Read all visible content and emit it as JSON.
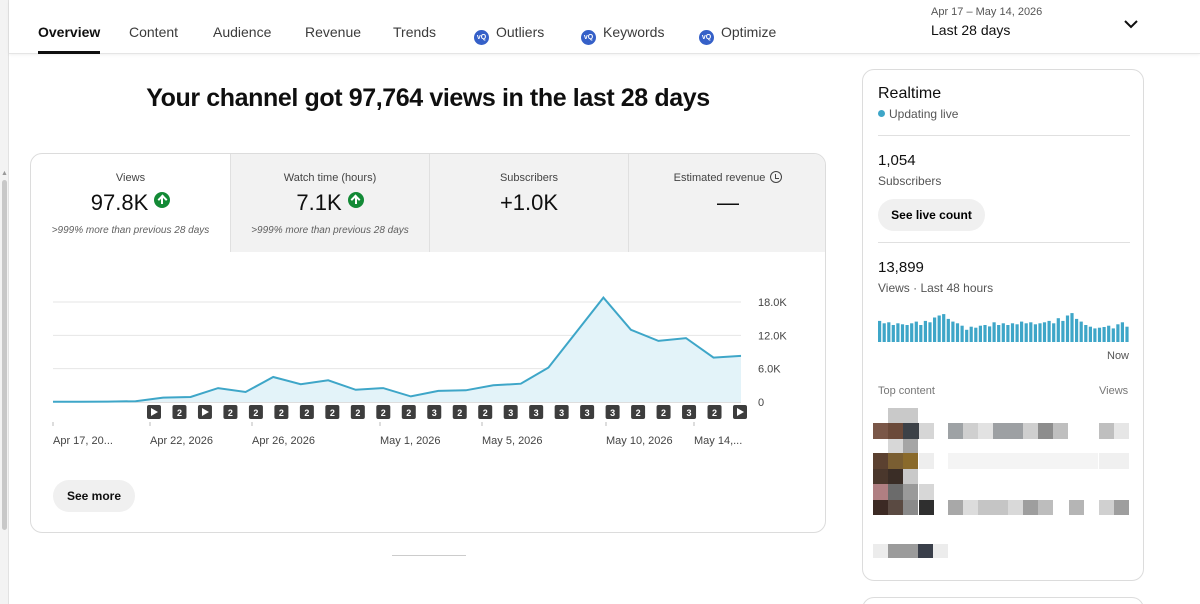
{
  "tabs": [
    {
      "label": "Overview",
      "active": true
    },
    {
      "label": "Content",
      "active": false
    },
    {
      "label": "Audience",
      "active": false
    },
    {
      "label": "Revenue",
      "active": false
    },
    {
      "label": "Trends",
      "active": false
    },
    {
      "label": "Outliers",
      "active": false,
      "icon": "outliers-icon"
    },
    {
      "label": "Keywords",
      "active": false,
      "icon": "keywords-icon"
    },
    {
      "label": "Optimize",
      "active": false,
      "icon": "optimize-icon"
    }
  ],
  "date_range": {
    "dates": "Apr 17 – May 14, 2026",
    "label": "Last 28 days",
    "icon": "chevron-down-icon"
  },
  "headline": "Your channel got 97,764 views in the last 28 days",
  "metrics": [
    {
      "label": "Views",
      "value": "97.8K",
      "trend": "up",
      "note": ">999% more than previous 28 days"
    },
    {
      "label": "Watch time (hours)",
      "value": "7.1K",
      "trend": "up",
      "note": ">999% more than previous 28 days"
    },
    {
      "label": "Subscribers",
      "value": "+1.0K"
    },
    {
      "label": "Estimated revenue",
      "value": "—",
      "icon": "clock-icon"
    }
  ],
  "chart_data": {
    "type": "area",
    "x": [
      "Apr 17",
      "Apr 18",
      "Apr 19",
      "Apr 20",
      "Apr 21",
      "Apr 22",
      "Apr 23",
      "Apr 24",
      "Apr 25",
      "Apr 26",
      "Apr 27",
      "Apr 28",
      "Apr 29",
      "Apr 30",
      "May 1",
      "May 2",
      "May 3",
      "May 4",
      "May 5",
      "May 6",
      "May 7",
      "May 8",
      "May 9",
      "May 10",
      "May 11",
      "May 12",
      "May 13",
      "May 14"
    ],
    "series": [
      {
        "values": [
          50,
          60,
          80,
          150,
          800,
          900,
          2500,
          1800,
          4500,
          3200,
          3900,
          2200,
          2500,
          1000,
          2000,
          2100,
          3000,
          3300,
          6200,
          12500,
          18800,
          13000,
          11000,
          11500,
          8000,
          8300
        ]
      }
    ],
    "x_tick_labels": [
      "Apr 17, 20...",
      "Apr 22, 2026",
      "Apr 26, 2026",
      "May 1, 2026",
      "May 5, 2026",
      "May 10, 2026",
      "May 14,..."
    ],
    "y_tick_labels": [
      "18.0K",
      "12.0K",
      "6.0K",
      "0"
    ],
    "ylim": [
      0,
      18000
    ],
    "color": "#3ea6c8",
    "fill": "#e3f3f9",
    "markers": [
      "play",
      "2",
      "play",
      "2",
      "2",
      "2",
      "2",
      "2",
      "2",
      "2",
      "2",
      "3",
      "2",
      "2",
      "3",
      "3",
      "3",
      "3",
      "3",
      "2",
      "2",
      "3",
      "2",
      "play"
    ],
    "see_more_label": "See more"
  },
  "realtime": {
    "title": "Realtime",
    "status": "Updating live",
    "subscribers_value": "1,054",
    "subscribers_label": "Subscribers",
    "see_live_label": "See live count",
    "views_value": "13,899",
    "views_label": "Views · Last 48 hours",
    "bars": [
      0.62,
      0.55,
      0.58,
      0.5,
      0.55,
      0.52,
      0.5,
      0.55,
      0.6,
      0.5,
      0.62,
      0.58,
      0.72,
      0.78,
      0.82,
      0.68,
      0.6,
      0.55,
      0.48,
      0.36,
      0.45,
      0.42,
      0.48,
      0.5,
      0.46,
      0.58,
      0.5,
      0.55,
      0.5,
      0.55,
      0.52,
      0.6,
      0.55,
      0.58,
      0.52,
      0.55,
      0.58,
      0.62,
      0.55,
      0.7,
      0.62,
      0.78,
      0.85,
      0.68,
      0.6,
      0.5,
      0.45,
      0.4,
      0.42,
      0.44,
      0.48,
      0.4,
      0.52,
      0.58,
      0.45
    ],
    "now_label": "Now",
    "top_content_label": "Top content",
    "views_col_label": "Views",
    "bar_color": "#3ea6c8"
  }
}
